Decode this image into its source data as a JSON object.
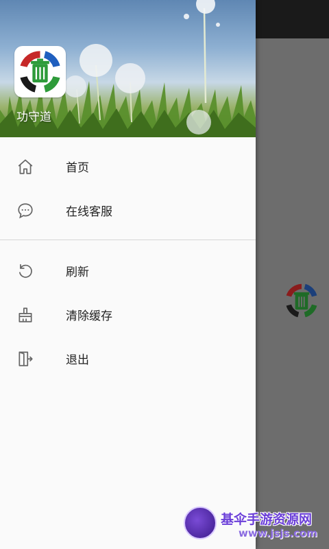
{
  "app": {
    "name": "功守道"
  },
  "drawer": {
    "menu_group_1": [
      {
        "label": "首页",
        "icon": "home-icon"
      },
      {
        "label": "在线客服",
        "icon": "chat-bubble-icon"
      }
    ],
    "menu_group_2": [
      {
        "label": "刷新",
        "icon": "refresh-icon"
      },
      {
        "label": "清除缓存",
        "icon": "broom-icon"
      },
      {
        "label": "退出",
        "icon": "exit-door-icon"
      }
    ]
  },
  "watermark": {
    "title": "基伞手游资源网",
    "url": "www.jsjs.com"
  },
  "colors": {
    "drawer_bg": "#fafafa",
    "scrim": "#6d6d6d",
    "logo_red": "#c62828",
    "logo_green": "#2e9b3a",
    "logo_blue": "#1f5fbf"
  }
}
